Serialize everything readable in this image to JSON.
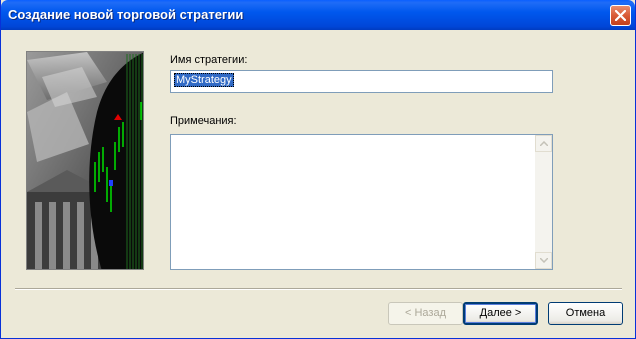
{
  "window": {
    "title": "Создание новой торговой стратегии"
  },
  "form": {
    "name_label": "Имя стратегии:",
    "name_value": "MyStrategy",
    "notes_label": "Примечания:",
    "notes_value": ""
  },
  "buttons": {
    "back": "< Назад",
    "next": "Далее >",
    "cancel": "Отмена"
  },
  "colors": {
    "titlebar": "#0054e3",
    "selection": "#316ac5",
    "dialog": "#ece9d8",
    "chart_green": "#00e000"
  }
}
